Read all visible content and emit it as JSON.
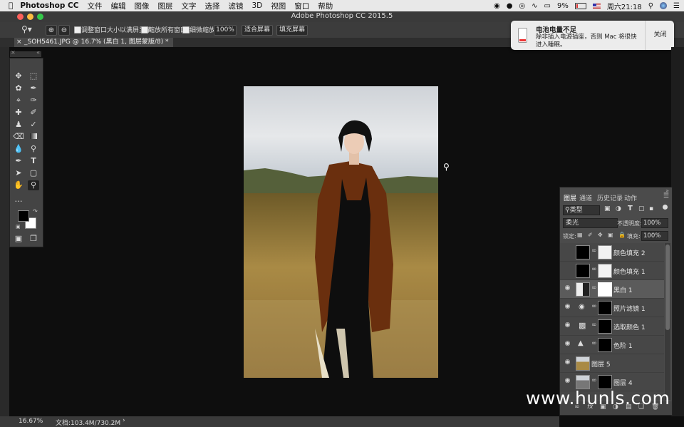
{
  "menubar": {
    "app": "Photoshop CC",
    "items": [
      "文件",
      "编辑",
      "图像",
      "图层",
      "文字",
      "选择",
      "滤镜",
      "3D",
      "视图",
      "窗口",
      "帮助"
    ],
    "battery": "9%",
    "clock": "周六21:18"
  },
  "window": {
    "title": "Adobe Photoshop CC 2015.5"
  },
  "options": {
    "resize_label": "调整窗口大小以满屏显示",
    "zoom_all_label": "缩放所有窗口",
    "scrubby_label": "细微缩放",
    "zoom_value": "100%",
    "fit_screen": "适合屏幕",
    "fill_screen": "填充屏幕"
  },
  "document": {
    "tab": "_SOH5461.JPG @ 16.7% (黑白 1, 图层蒙版/8) *"
  },
  "notification": {
    "title": "电池电量不足",
    "body": "除非插入电源插座，否则 Mac 将很快进入睡眠。",
    "close": "关闭"
  },
  "layers": {
    "tabs": [
      "图层",
      "通道",
      "历史记录",
      "动作"
    ],
    "filter": "类型",
    "blend_mode": "柔光",
    "opacity_label": "不透明度:",
    "opacity": "100%",
    "lock_label": "锁定:",
    "fill_label": "填充:",
    "fill": "100%",
    "rows": [
      {
        "name": "颜色填充 2",
        "visible": false
      },
      {
        "name": "颜色填充 1",
        "visible": false
      },
      {
        "name": "黑白 1",
        "visible": true
      },
      {
        "name": "照片滤镜 1",
        "visible": true
      },
      {
        "name": "选取颜色 1",
        "visible": true
      },
      {
        "name": "色阶 1",
        "visible": true
      },
      {
        "name": "图层 5",
        "visible": true
      },
      {
        "name": "图层 4",
        "visible": true
      }
    ]
  },
  "status": {
    "zoom": "16.67%",
    "doc_size": "文档:103.4M/730.2M"
  },
  "watermark": "www.hunls.com",
  "colors": {
    "foreground": "#000000",
    "background": "#ffffff"
  }
}
